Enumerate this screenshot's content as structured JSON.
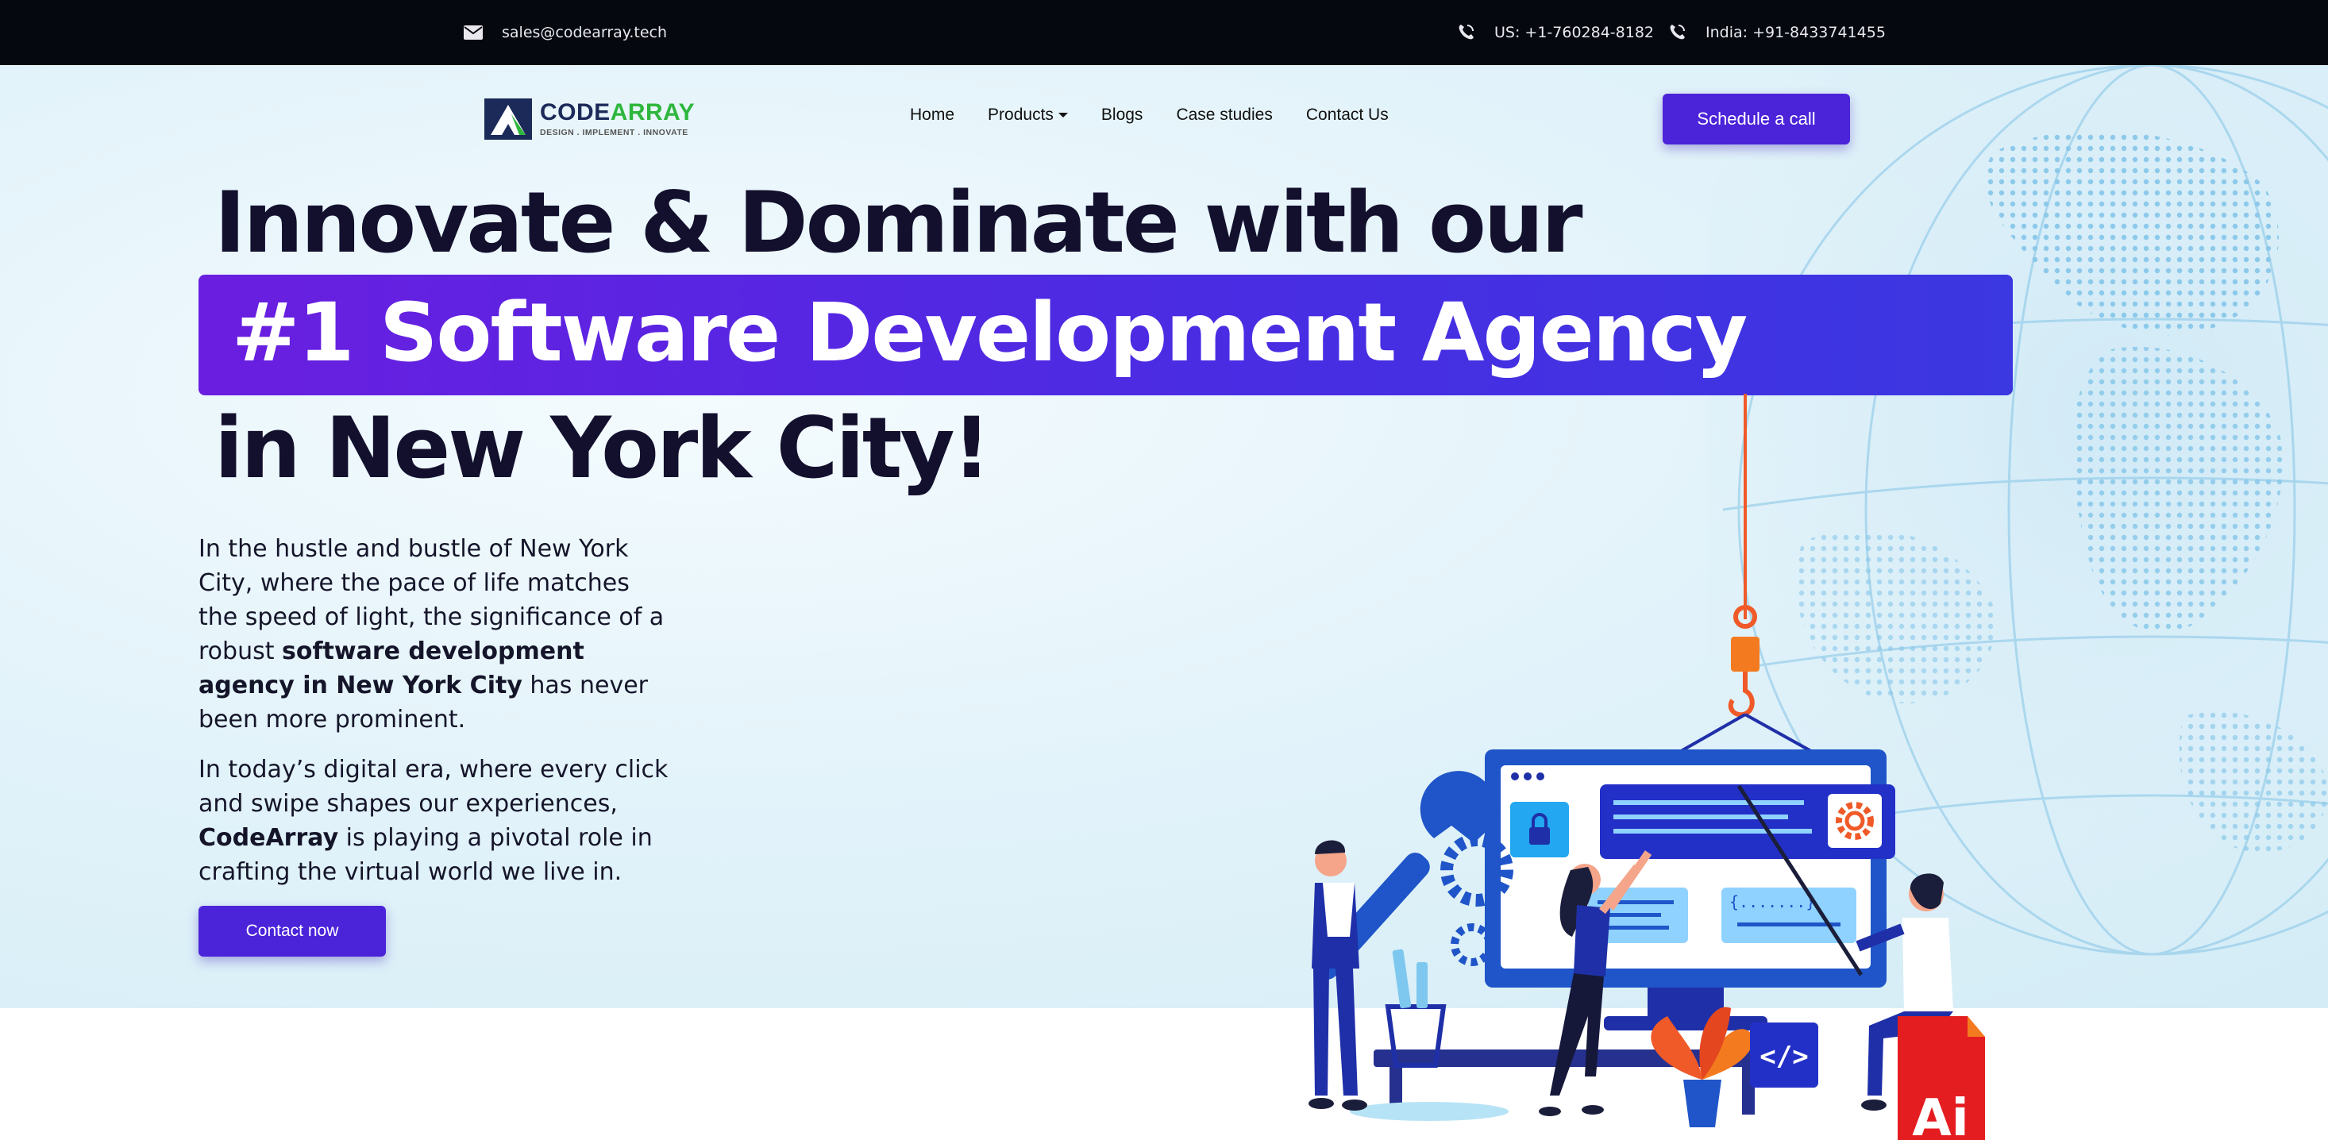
{
  "topbar": {
    "email_icon": "envelope-icon",
    "email": "sales@codearray.tech",
    "phone_icon": "phone-icon",
    "us_phone": "US: +1-760284-8182",
    "india_phone": "India: +91-8433741455"
  },
  "brand": {
    "name_part1": "CODE",
    "name_part2": "ARRAY",
    "tagline": "DESIGN . IMPLEMENT . INNOVATE"
  },
  "nav": {
    "items": [
      "Home",
      "Products",
      "Blogs",
      "Case studies",
      "Contact Us"
    ],
    "cta": "Schedule a call"
  },
  "hero": {
    "line1": "Innovate & Dominate with our",
    "line2": "#1 Software Development Agency",
    "line3": "in New York City!",
    "para1_a": "In the hustle and bustle of New York City, where the pace of life matches the speed of light, the significance of a robust ",
    "para1_bold": "software development agency in New York City",
    "para1_b": " has never been more prominent.",
    "para2_a": "In today’s digital era, where every click and swipe shapes our experiences, ",
    "para2_bold": "CodeArray",
    "para2_b": " is playing a pivotal role in crafting the virtual world we live in.",
    "cta": "Contact now"
  },
  "illustration": {
    "code_tag": "</>",
    "ai_badge": "Ai",
    "braces": "{.......}"
  },
  "colors": {
    "topbar_bg": "#06080f",
    "accent_purple": "#4b23d9",
    "brand_green": "#2eb63d",
    "headline": "#13102e"
  }
}
